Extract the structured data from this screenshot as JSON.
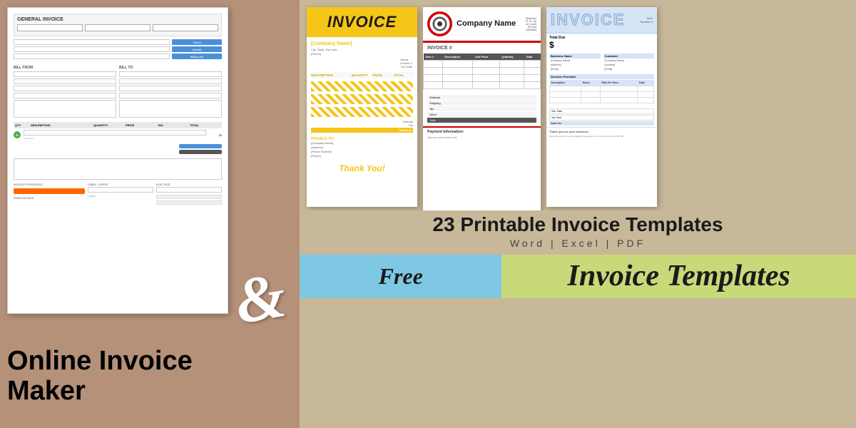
{
  "left": {
    "title": "GENERAL INVOICE",
    "online_invoice_line1": "Online Invoice",
    "online_invoice_line2": "Maker",
    "ampersand": "&"
  },
  "templates": {
    "yellow": {
      "title": "INVOICE",
      "company_name": "[Company Name]",
      "fields": [
        "Name:",
        "Invoice #",
        "The Date:"
      ],
      "columns": [
        "DESCRIPTION",
        "QUANTITY",
        "PRICE",
        "TOTAL"
      ],
      "subtotal_label": "Subtotal",
      "tax_label": "Tax",
      "total_due_label": "Total Due",
      "payable_to": "PAYABLE TO:",
      "payable_fields": [
        "[Company Name]",
        "[Address]",
        "[Phone Number]",
        "[Phone]"
      ],
      "thank_you": "Thank You!"
    },
    "company": {
      "company_name": "Company Name",
      "invoice_hash": "INVOICE #",
      "contact_lines": [
        "[Address]",
        "Ct. St. Zip",
        "An Code)",
        "[Phone]",
        "[Website]"
      ],
      "table_headers": [
        "Item #",
        "Description",
        "Unit Price",
        "Quantity",
        "Total"
      ],
      "subtotal_rows": [
        "Subtotal",
        "Shipping",
        "Tax",
        "Other",
        "Total"
      ],
      "payment_info": "Payment Information:",
      "payment_text": "Add your bank details here"
    },
    "blue": {
      "title": "INVOICE",
      "table_headers": [
        "Item",
        "Number #"
      ],
      "total_label": "$",
      "bill_from": "Business Name",
      "bill_to": "Customer",
      "from_fields": [
        "[Company Name]",
        "[Address]",
        "[Email]"
      ],
      "to_fields": [
        "[Company Name]",
        "[Address]",
        "[Email]"
      ],
      "services_header": "Services Provided",
      "services_cols": [
        "Description",
        "Hours",
        "Rate Per Hour",
        "Total"
      ],
      "thank_you": "Thank you for your business",
      "comment": "Send all questions to goodmail@companyname.com or call us at 123-456-789"
    }
  },
  "banner": {
    "printable_line1": "23 Printable Invoice Templates",
    "formats": "Word  |  Excel  |  PDF",
    "free_label": "Free",
    "invoice_templates_label": "Invoice Templates"
  }
}
